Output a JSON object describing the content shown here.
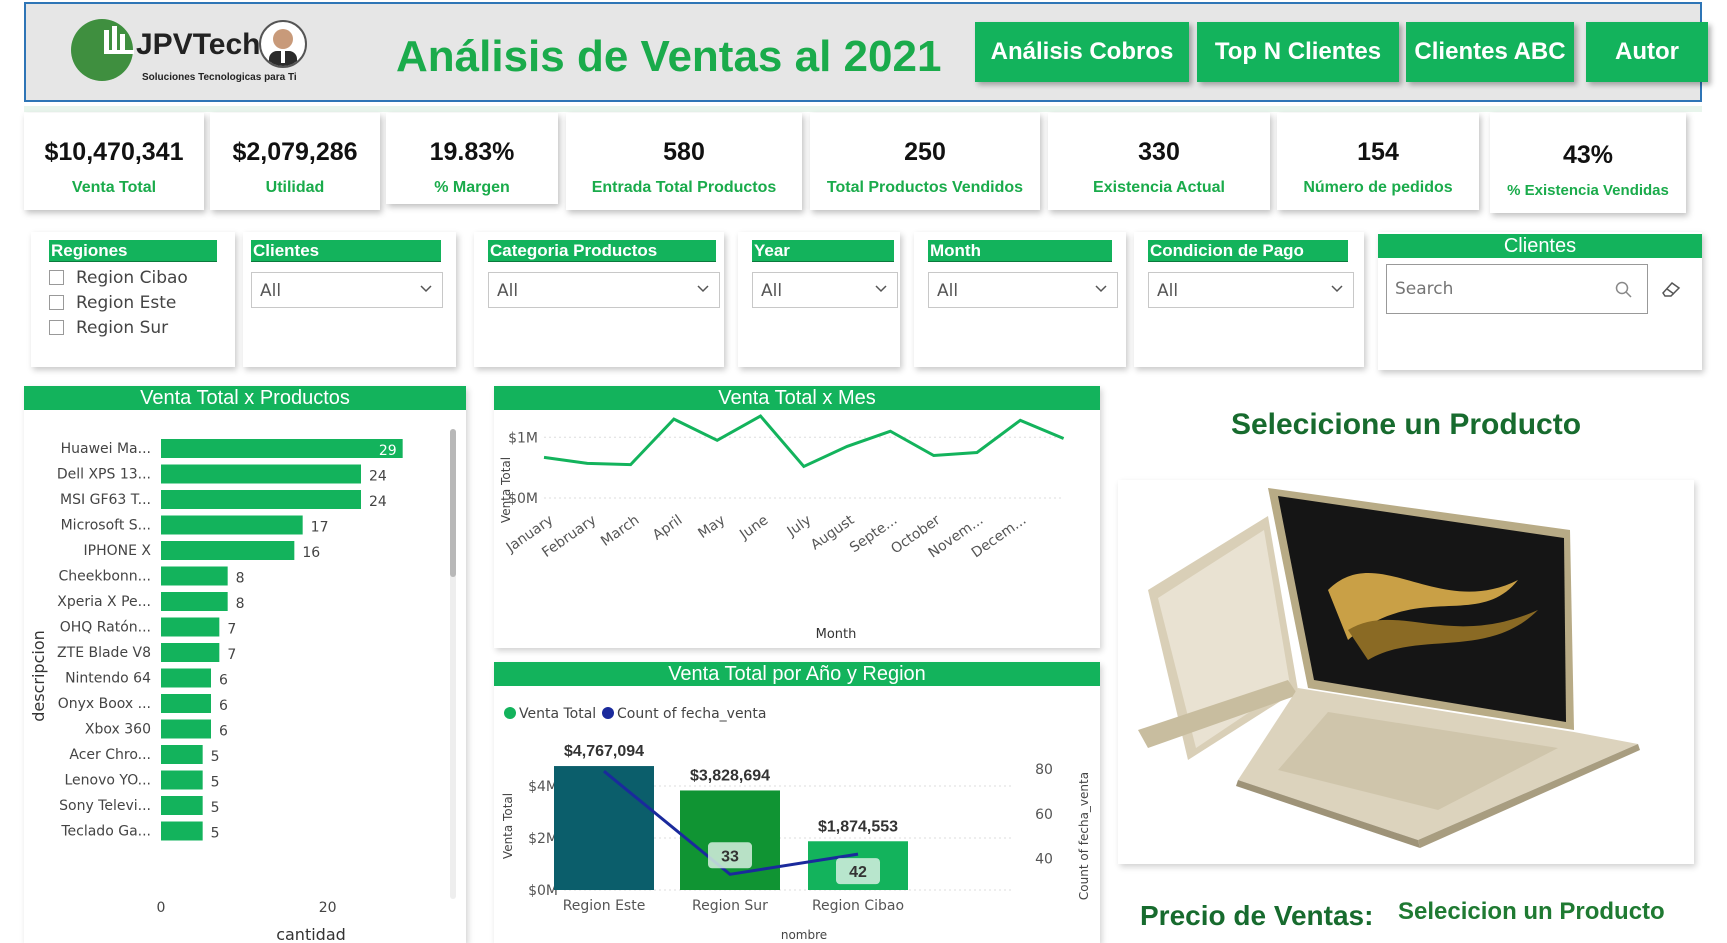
{
  "header": {
    "logo_text": "JPVTech",
    "logo_tagline": "Soluciones Tecnologicas para Ti",
    "title": "Análisis de Ventas al 2021",
    "nav": [
      "Análisis Cobros",
      "Top N Clientes",
      "Clientes ABC",
      "Autor"
    ]
  },
  "kpis": [
    {
      "value": "$10,470,341",
      "label": "Venta Total"
    },
    {
      "value": "$2,079,286",
      "label": "Utilidad"
    },
    {
      "value": "19.83%",
      "label": "% Margen"
    },
    {
      "value": "580",
      "label": "Entrada Total Productos"
    },
    {
      "value": "250",
      "label": "Total Productos Vendidos"
    },
    {
      "value": "330",
      "label": "Existencia Actual"
    },
    {
      "value": "154",
      "label": "Número de pedidos"
    },
    {
      "value": "43%",
      "label": "% Existencia Vendidas"
    }
  ],
  "slicers": {
    "regiones": {
      "title": "Regiones",
      "items": [
        "Region Cibao",
        "Region Este",
        "Region Sur"
      ]
    },
    "clientes": {
      "title": "Clientes",
      "value": "All"
    },
    "categoria": {
      "title": "Categoria Productos",
      "value": "All"
    },
    "year": {
      "title": "Year",
      "value": "All"
    },
    "month": {
      "title": "Month",
      "value": "All"
    },
    "condicion": {
      "title": "Condicion de Pago",
      "value": "All"
    },
    "clientes_search": {
      "title": "Clientes",
      "placeholder": "Search"
    }
  },
  "visuals": {
    "productos_title": "Venta Total x Productos",
    "mes_title": "Venta Total x Mes",
    "region_title": "Venta Total por Año y Region",
    "select_product": "Selecicione un Producto",
    "precio_label": "Precio de Ventas:",
    "precio_value": "Selecicion un Producto"
  },
  "chart_data": [
    {
      "type": "bar",
      "title": "Venta Total x Productos",
      "orientation": "horizontal",
      "xlabel": "cantidad",
      "ylabel": "descripcion",
      "categories": [
        "Huawei Ma...",
        "Dell XPS 13...",
        "MSI GF63 T...",
        "Microsoft S...",
        "IPHONE X",
        "Cheekbonn...",
        "Xperia X Pe...",
        "OHQ Ratón...",
        "ZTE Blade V8",
        "Nintendo 64",
        "Onyx Boox ...",
        "Xbox 360",
        "Acer Chro...",
        "Lenovo YO...",
        "Sony Televi...",
        "Teclado Ga..."
      ],
      "values": [
        29,
        24,
        24,
        17,
        16,
        8,
        8,
        7,
        7,
        6,
        6,
        6,
        5,
        5,
        5,
        5
      ],
      "x_ticks": [
        "0",
        "20"
      ],
      "xlim": [
        0,
        30
      ],
      "color": "#13b35c"
    },
    {
      "type": "line",
      "title": "Venta Total x Mes",
      "xlabel": "Month",
      "ylabel": "Venta Total",
      "categories": [
        "January",
        "February",
        "March",
        "April",
        "May",
        "June",
        "July",
        "August",
        "Septe...",
        "October",
        "Novem...",
        "Decem..."
      ],
      "values": [
        0.67,
        0.57,
        0.55,
        1.3,
        0.95,
        1.35,
        0.52,
        0.85,
        1.1,
        0.7,
        0.75,
        1.28,
        0.98
      ],
      "y_ticks": [
        "$0M",
        "$1M"
      ],
      "ylim": [
        0,
        1.45
      ],
      "color": "#13b35c"
    },
    {
      "type": "bar",
      "title": "Venta Total por Año y Region",
      "legend": [
        "Venta Total",
        "Count of fecha_venta"
      ],
      "xlabel": "nombre",
      "ylabel": "Venta Total",
      "y2label": "Count of fecha_venta",
      "categories": [
        "Region Este",
        "Region Sur",
        "Region Cibao"
      ],
      "series": [
        {
          "name": "Venta Total",
          "values": [
            4767094,
            3828694,
            1874553
          ],
          "labels": [
            "$4,767,094",
            "$3,828,694",
            "$1,874,553"
          ],
          "colors": [
            "#0b5e6b",
            "#109433",
            "#13b35c"
          ]
        },
        {
          "name": "Count of fecha_venta",
          "values": [
            79,
            33,
            42
          ],
          "labels": [
            "",
            "33",
            "42"
          ],
          "color": "#1a2a9c"
        }
      ],
      "y_ticks": [
        "$0M",
        "$2M",
        "$4M"
      ],
      "ylim": [
        0,
        5000000
      ],
      "y2_ticks": [
        "40",
        "60",
        "80"
      ],
      "y2lim": [
        26,
        84
      ]
    }
  ]
}
